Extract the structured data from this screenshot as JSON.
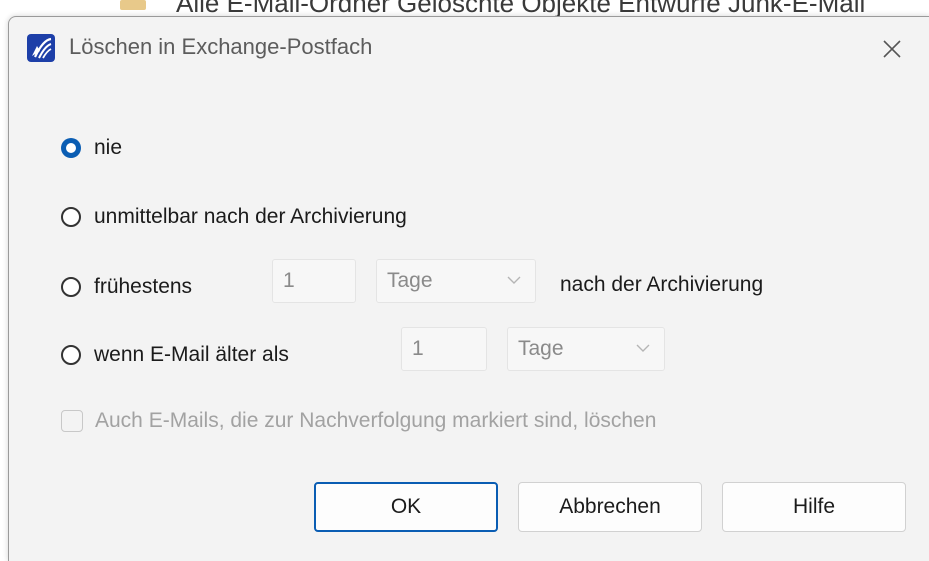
{
  "background": {
    "text": "Alle E-Mail-Ordner Gelöschte Objekte Entwürfe Junk-E-Mail"
  },
  "dialog": {
    "title": "Löschen in Exchange-Postfach",
    "close_icon": "close-icon",
    "app_icon": "app-icon"
  },
  "options": {
    "never": "nie",
    "immediately": "unmittelbar nach der Archivierung",
    "earliest": "frühestens",
    "earliest_value": "1",
    "earliest_unit": "Tage",
    "earliest_suffix": "nach der Archivierung",
    "older_than": "wenn E-Mail älter als",
    "older_value": "1",
    "older_unit": "Tage",
    "selected": "nie"
  },
  "flagged": {
    "label": "Auch E-Mails, die zur Nachverfolgung markiert sind, löschen",
    "checked": false,
    "enabled": false
  },
  "buttons": {
    "ok": "OK",
    "cancel": "Abbrechen",
    "help": "Hilfe"
  },
  "colors": {
    "accent": "#0a5db3",
    "dialog_bg": "#f3f3f3",
    "disabled_text": "#a2a2a2"
  }
}
